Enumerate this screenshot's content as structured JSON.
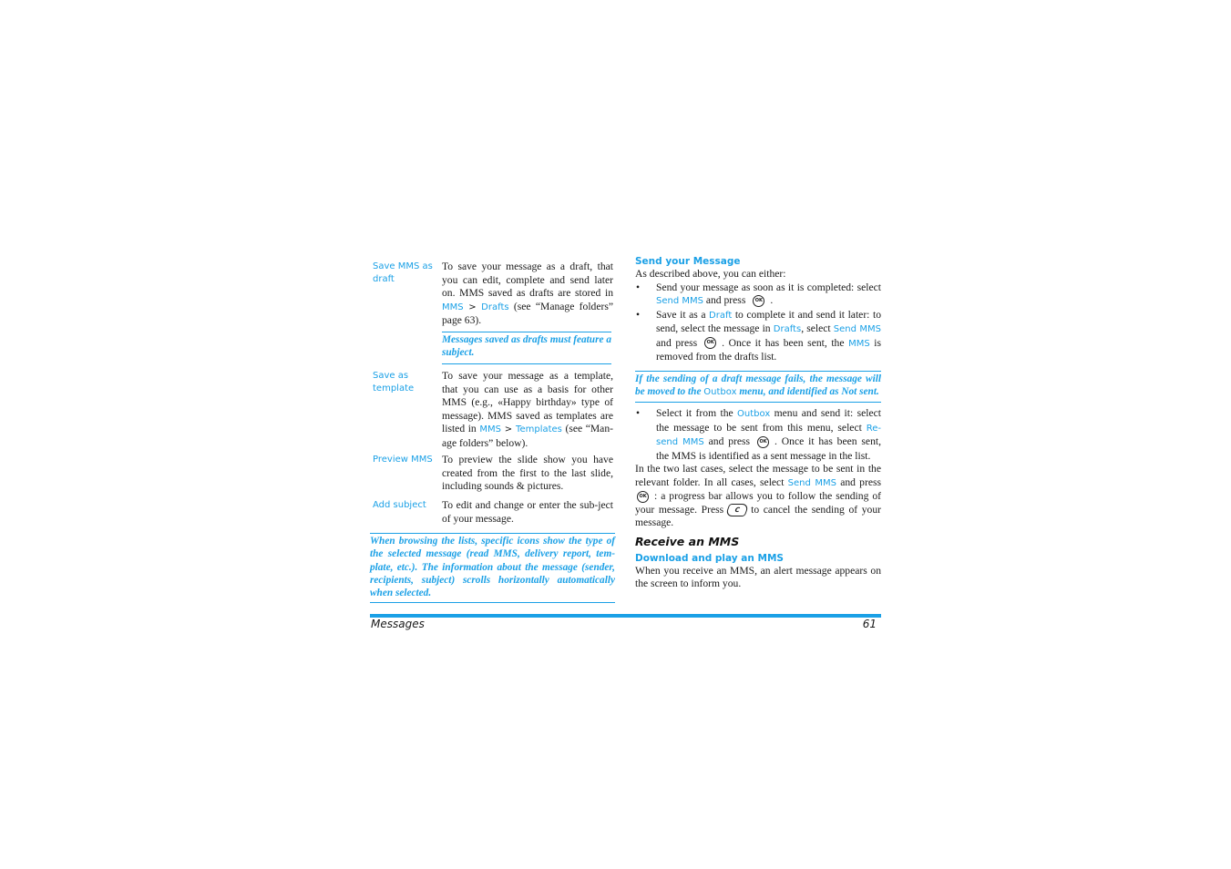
{
  "left": {
    "options": [
      {
        "label": "Save MMS as draft",
        "desc_pre": "To save your message as a draft, that you can edit, complete and send later on. MMS saved as drafts are stored in ",
        "term1": "MMS",
        "sep": " > ",
        "term2": "Drafts",
        "desc_post": " (see “Manage folders” page 63)."
      },
      {
        "label": "Save as template",
        "desc_pre": "To save your message as a template, that you can use as a basis for other MMS (e.g., «Happy birthday» type of message). MMS saved as templates are listed in ",
        "term1": "MMS",
        "sep": " > ",
        "term2": "Templates",
        "desc_post": " (see “Man-age folders” below)."
      },
      {
        "label": "Preview MMS",
        "desc": "To preview the slide show you have created from the first to the last slide, including sounds & pictures."
      },
      {
        "label": "Add subject",
        "desc": "To edit and change or enter the sub-ject of your message."
      }
    ],
    "draft_note": "Messages saved as drafts must feature a subject.",
    "browse_note": "When browsing the lists, specific icons show the type of the selected message (read MMS, delivery report, tem-plate, etc.). The information about the message (sender, recipients, subject) scrolls horizontally automatically when selected."
  },
  "right": {
    "send_heading": "Send your Message",
    "intro": "As described above, you can either:",
    "bullet1": {
      "pre": "Send your message as soon as it is completed: select ",
      "term": "Send MMS",
      "mid": " and press",
      "post": "."
    },
    "bullet2": {
      "a": "Save it as a ",
      "t1": "Draft",
      "b": " to complete it and send it later: to send, select the message in ",
      "t2": "Drafts",
      "c": ", select ",
      "t3": "Send MMS",
      "d": " and press",
      "e": ". Once it has been sent, the ",
      "t4": "MMS",
      "f": " is removed from the drafts list."
    },
    "fail_note": {
      "a": "If the sending of a draft message fails, the message will be moved to the ",
      "term": "Outbox",
      "b": " menu, and identified as Not sent."
    },
    "bullet3": {
      "a": "Select it from the ",
      "t1": "Outbox",
      "b": " menu and send it: select the message to be sent from this menu, select ",
      "t2": "Re-send MMS",
      "c": " and press",
      "d": ". Once it has been sent, the MMS is identified as a sent message in the list."
    },
    "para": {
      "a": "In the two last cases, select the message to be sent in the relevant folder. In all cases, select ",
      "term": "Send MMS",
      "b": " and press",
      "c": ": a progress bar allows you to follow the sending of your message. Press",
      "d": "to cancel the sending of your message."
    },
    "receive_heading": "Receive an MMS",
    "download_heading": "Download and play an MMS",
    "download_text": "When you receive an MMS, an alert message appears on the screen to inform you."
  },
  "keys": {
    "ok": "OK",
    "c": "C"
  },
  "footer": {
    "section": "Messages",
    "page": "61"
  }
}
